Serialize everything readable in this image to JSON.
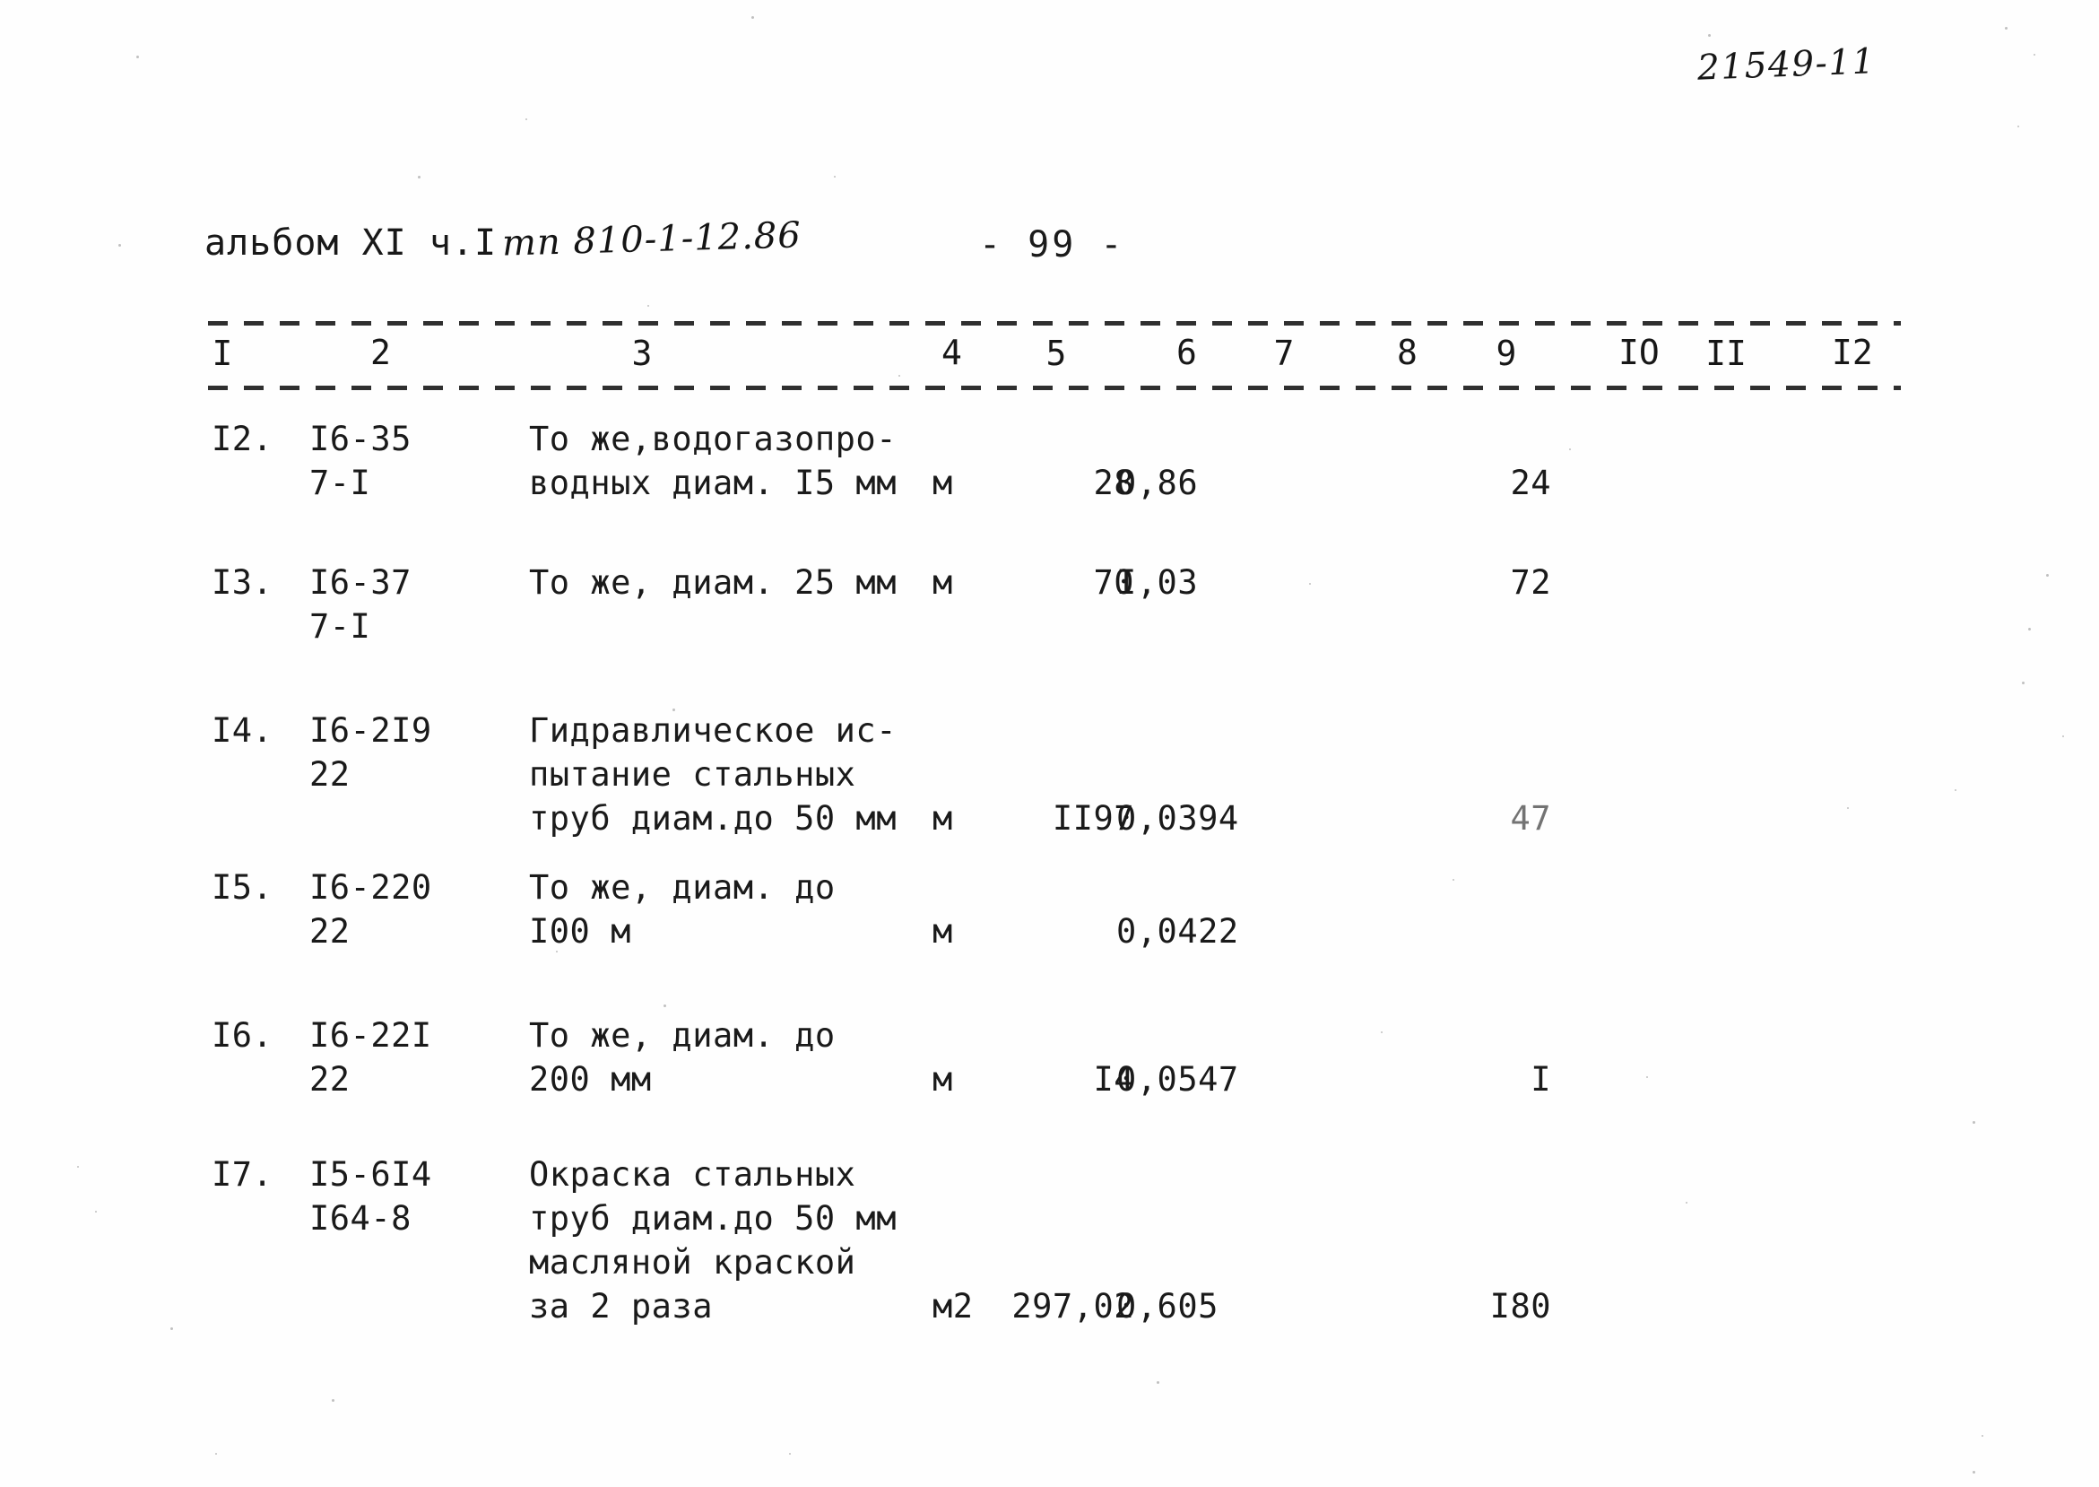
{
  "header": {
    "album": "альбом XI  ч.I",
    "tp_handwritten": "тп 810-1-12.86",
    "page_number": "- 99 -",
    "stamp_handwritten": "21549-11"
  },
  "table": {
    "column_numbers": [
      "I",
      "2",
      "3",
      "4",
      "5",
      "6",
      "7",
      "8",
      "9",
      "IO",
      "II",
      "I2"
    ],
    "rows": [
      {
        "num": "I2.",
        "code_line1": "I6-35",
        "code_line2": "7-I",
        "desc_line1": "То же,водогазопро-",
        "desc_line2": "водных диам. I5 мм",
        "desc_line3": "",
        "desc_line4": "",
        "unit": "м",
        "qty": "28",
        "price": "0,86",
        "col9": "24"
      },
      {
        "num": "I3.",
        "code_line1": "I6-37",
        "code_line2": "7-I",
        "desc_line1": "То же, диам. 25 мм",
        "desc_line2": "",
        "desc_line3": "",
        "desc_line4": "",
        "unit": "м",
        "qty": "70",
        "price": "I,03",
        "col9": "72"
      },
      {
        "num": "I4.",
        "code_line1": "I6-2I9",
        "code_line2": "22",
        "desc_line1": "Гидравлическое ис-",
        "desc_line2": "пытание стальных",
        "desc_line3": "труб диам.до 50 мм",
        "desc_line4": "",
        "unit": "м",
        "qty": "II97",
        "price": "0,0394",
        "col9": "47"
      },
      {
        "num": "I5.",
        "code_line1": "I6-220",
        "code_line2": "22",
        "desc_line1": "То же, диам. до",
        "desc_line2": "I00 м",
        "desc_line3": "",
        "desc_line4": "",
        "unit": "м",
        "qty": "",
        "price": "0,0422",
        "col9": ""
      },
      {
        "num": "I6.",
        "code_line1": "I6-22I",
        "code_line2": "22",
        "desc_line1": "То же, диам. до",
        "desc_line2": "200 мм",
        "desc_line3": "",
        "desc_line4": "",
        "unit": "м",
        "qty": "I4",
        "price": "0,0547",
        "col9": "I"
      },
      {
        "num": "I7.",
        "code_line1": "I5-6I4",
        "code_line2": "I64-8",
        "desc_line1": "Окраска стальных",
        "desc_line2": "труб диам.до 50 мм",
        "desc_line3": "масляной краской",
        "desc_line4": "за 2 раза",
        "unit": "м2",
        "qty": "297,02",
        "price": "0,605",
        "col9": "I80"
      }
    ]
  },
  "colors": {
    "ink": "#1a1a1a",
    "paper": "#fefefe",
    "faint_ink": "#555555"
  }
}
